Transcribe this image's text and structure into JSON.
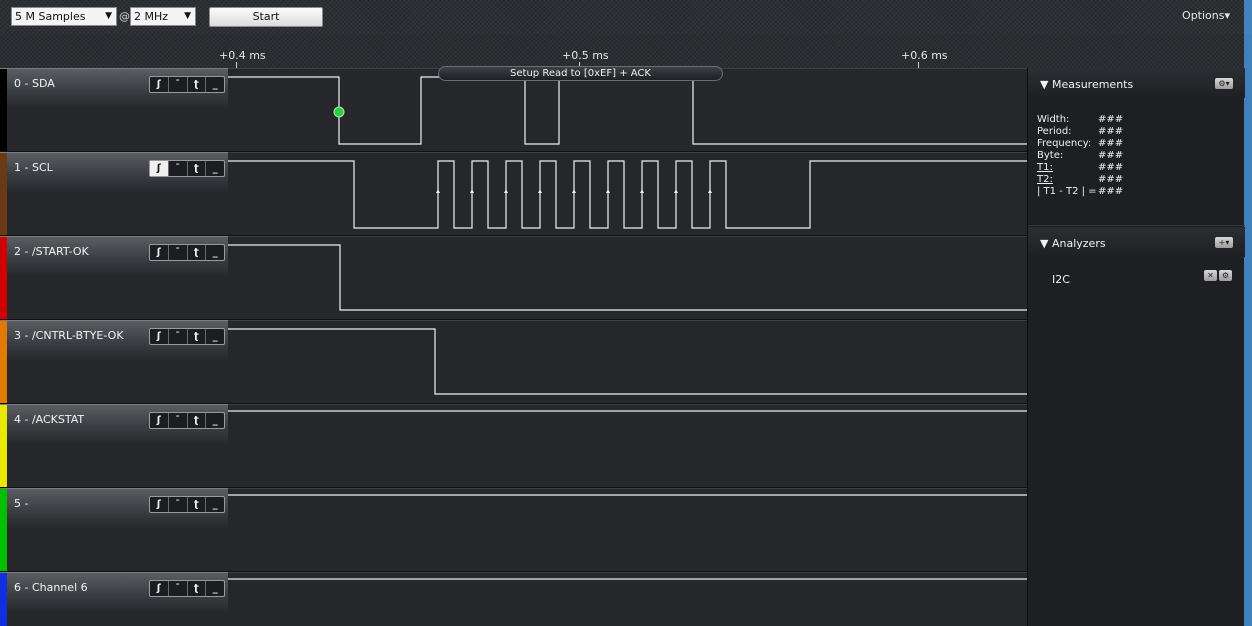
{
  "toolbar": {
    "samples": "5 M Samples",
    "at": "@",
    "rate": "2 MHz",
    "start_label": "Start",
    "options_label": "Options▾"
  },
  "ruler": {
    "ticks": [
      "+0.4 ms",
      "+0.5 ms",
      "+0.6 ms"
    ]
  },
  "annotation": "Setup Read to [0xEF] + ACK",
  "channels": [
    {
      "name": "0 - SDA",
      "color": "#000000"
    },
    {
      "name": "1 - SCL",
      "color": "#6b3a14"
    },
    {
      "name": "2 - /START-OK",
      "color": "#d00000"
    },
    {
      "name": "3 - /CNTRL-BTYE-OK",
      "color": "#e07a00"
    },
    {
      "name": "4 - /ACKSTAT",
      "color": "#e8e800"
    },
    {
      "name": "5 -",
      "color": "#00c000"
    },
    {
      "name": "6 - Channel 6",
      "color": "#1030e0"
    }
  ],
  "trigger_icons": [
    "rising-edge-icon",
    "high-level-icon",
    "falling-edge-icon",
    "low-level-icon"
  ],
  "measurements": {
    "title": "Measurements",
    "rows": [
      {
        "k": "Width:",
        "v": "###"
      },
      {
        "k": "Period:",
        "v": "###"
      },
      {
        "k": "Frequency:",
        "v": "###"
      },
      {
        "k": "Byte:",
        "v": "###"
      },
      {
        "k": "T1:",
        "v": "###"
      },
      {
        "k": "T2:",
        "v": "###"
      },
      {
        "k": "| T1 - T2 | =",
        "v": "###"
      }
    ]
  },
  "analyzers": {
    "title": "Analyzers",
    "items": [
      "I2C"
    ]
  }
}
